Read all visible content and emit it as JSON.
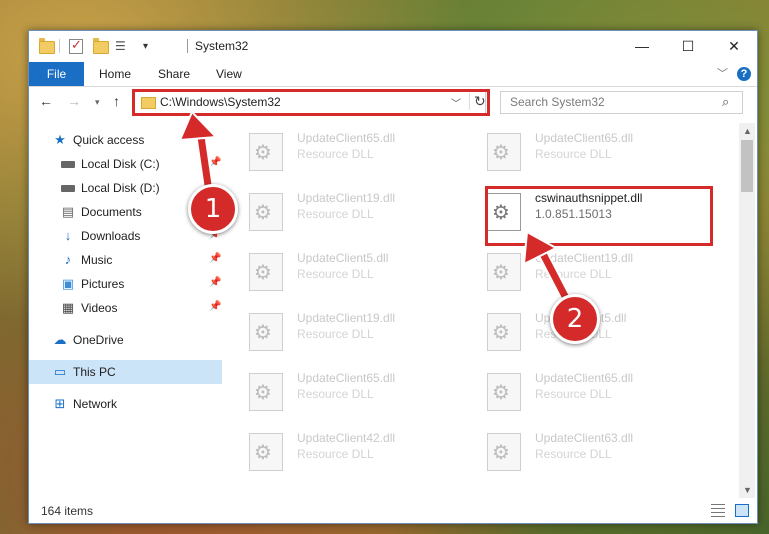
{
  "window": {
    "title": "System32",
    "controls": {
      "minimize": "—",
      "maximize": "☐",
      "close": "✕"
    }
  },
  "ribbon": {
    "file": "File",
    "tabs": [
      "Home",
      "Share",
      "View"
    ]
  },
  "address": {
    "path": "C:\\Windows\\System32",
    "search_placeholder": "Search System32"
  },
  "sidebar": {
    "items": [
      {
        "label": "Quick access",
        "icon": "star-icon"
      },
      {
        "label": "Local Disk (C:)",
        "icon": "disk-icon"
      },
      {
        "label": "Local Disk (D:)",
        "icon": "disk-icon"
      },
      {
        "label": "Documents",
        "icon": "documents-icon"
      },
      {
        "label": "Downloads",
        "icon": "download-icon"
      },
      {
        "label": "Music",
        "icon": "music-icon"
      },
      {
        "label": "Pictures",
        "icon": "pictures-icon"
      },
      {
        "label": "Videos",
        "icon": "videos-icon"
      },
      {
        "label": "OneDrive",
        "icon": "cloud-icon"
      },
      {
        "label": "This PC",
        "icon": "computer-icon"
      },
      {
        "label": "Network",
        "icon": "network-icon"
      }
    ]
  },
  "files": [
    {
      "name": "UpdateClient65.dll",
      "type": "Resource DLL"
    },
    {
      "name": "UpdateClient65.dll",
      "type": "Resource DLL"
    },
    {
      "name": "UpdateClient19.dll",
      "type": "Resource DLL"
    },
    {
      "name": "cswinauthsnippet.dll",
      "type": "1.0.851.15013"
    },
    {
      "name": "UpdateClient5.dll",
      "type": "Resource DLL"
    },
    {
      "name": "UpdateClient19.dll",
      "type": "Resource DLL"
    },
    {
      "name": "UpdateClient19.dll",
      "type": "Resource DLL"
    },
    {
      "name": "UpdateClient5.dll",
      "type": "Resource DLL"
    },
    {
      "name": "UpdateClient65.dll",
      "type": "Resource DLL"
    },
    {
      "name": "UpdateClient65.dll",
      "type": "Resource DLL"
    },
    {
      "name": "UpdateClient42.dll",
      "type": "Resource DLL"
    },
    {
      "name": "UpdateClient63.dll",
      "type": "Resource DLL"
    }
  ],
  "status": {
    "item_count": "164 items"
  },
  "annotations": {
    "step1": "1",
    "step2": "2",
    "color": "#d42a2a"
  }
}
